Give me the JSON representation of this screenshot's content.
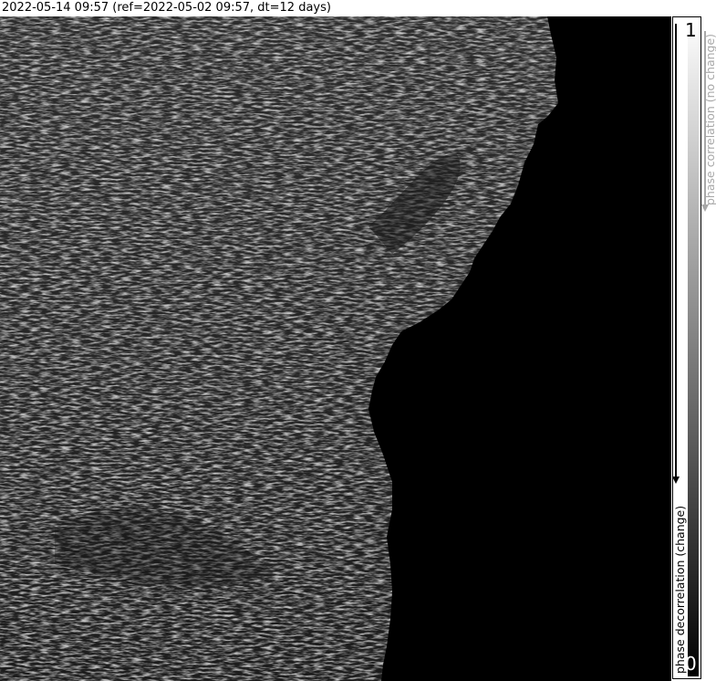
{
  "header": {
    "title": "2022-05-14 09:57 (ref=2022-05-02 09:57, dt=12 days)"
  },
  "colorbar": {
    "max_label": "1",
    "min_label": "0",
    "top_label": "phase correlation (no change)",
    "bottom_label": "phase decorrelation (change)",
    "top_color": "#ffffff",
    "bottom_color": "#000000"
  },
  "image": {
    "description_icon": "sar-coherence-map",
    "land_color": "#3a3a3a",
    "sea_color": "#000000"
  }
}
